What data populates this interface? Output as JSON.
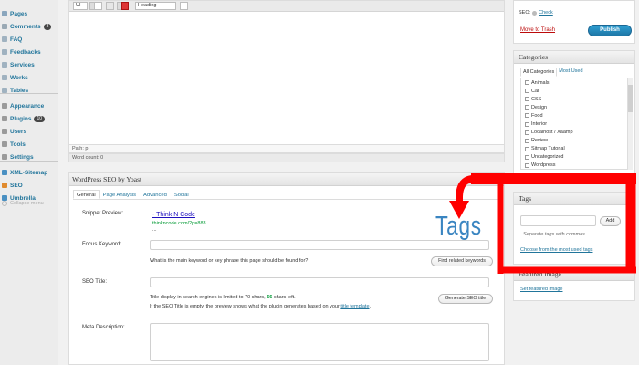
{
  "sidebar": {
    "items": [
      {
        "label": "Pages",
        "icon": "pages-icon",
        "color": "#8aa6bd"
      },
      {
        "label": "Comments",
        "icon": "comments-icon",
        "color": "#9aa9b4",
        "count": "3"
      },
      {
        "label": "FAQ",
        "icon": "faq-icon",
        "color": "#a0b2c0"
      },
      {
        "label": "Feedbacks",
        "icon": "feedbacks-icon",
        "color": "#a0b2c0"
      },
      {
        "label": "Services",
        "icon": "services-icon",
        "color": "#a0b2c0"
      },
      {
        "label": "Works",
        "icon": "works-icon",
        "color": "#a0b2c0"
      },
      {
        "label": "Tables",
        "icon": "tables-icon",
        "color": "#a0b2c0"
      },
      {
        "label": "Appearance",
        "icon": "appearance-icon",
        "color": "#9a9a9a"
      },
      {
        "label": "Plugins",
        "icon": "plugins-icon",
        "color": "#9a9a9a",
        "count": "10"
      },
      {
        "label": "Users",
        "icon": "users-icon",
        "color": "#9a9a9a"
      },
      {
        "label": "Tools",
        "icon": "tools-icon",
        "color": "#9a9a9a"
      },
      {
        "label": "Settings",
        "icon": "settings-icon",
        "color": "#9a9a9a"
      },
      {
        "label": "XML-Sitemap",
        "icon": "sitemap-icon",
        "color": "#4a90c2"
      },
      {
        "label": "SEO",
        "icon": "seo-icon",
        "color": "#e08a2e"
      },
      {
        "label": "Umbrella",
        "icon": "umbrella-icon",
        "color": "#4a90c2"
      }
    ],
    "collapse_label": "Collapse menu"
  },
  "editor": {
    "toolbar": {
      "format_select": "Heading",
      "list_select": "UI"
    },
    "path_label": "Path: p",
    "word_count": "Word count: 0"
  },
  "seo": {
    "title": "WordPress SEO by Yoast",
    "tabs": [
      "General",
      "Page Analysis",
      "Advanced",
      "Social"
    ],
    "snippet_label": "Snippet Preview:",
    "snippet_title": "- Think N Code",
    "snippet_url": "thinkncode.com/?p=883",
    "snippet_desc": "...",
    "focus_label": "Focus Keyword:",
    "focus_help": "What is the main keyword or key phrase this page should be found for?",
    "focus_button": "Find related keywords",
    "title_label": "SEO Title:",
    "title_help_pre": "Title display in search engines is limited to 70 chars,",
    "title_help_num": "56",
    "title_help_post": "chars left.",
    "title_help2_pre": "If the SEO Title is empty, the preview shows what the plugin generates based on your",
    "title_help2_link": "title template",
    "title_help2_end": ".",
    "title_button": "Generate SEO title",
    "meta_label": "Meta Description:"
  },
  "publish": {
    "seo_label": "SEO:",
    "seo_check": "Check",
    "trash_label": "Move to Trash",
    "publish_button": "Publish"
  },
  "categories": {
    "title": "Categories",
    "tab_all": "All Categories",
    "tab_used": "Most Used",
    "items": [
      "Animals",
      "Car",
      "CSS",
      "Design",
      "Food",
      "Interior",
      "Localhost / Xaamp",
      "Review",
      "Sitmap Tutorial",
      "Uncategorized",
      "Wordpress"
    ]
  },
  "tags": {
    "title": "Tags",
    "add_button": "Add",
    "hint": "Separate tags with commas",
    "choose_link": "Choose from the most used tags"
  },
  "featured": {
    "title": "Featured Image",
    "link": "Set featured image"
  },
  "annotation": {
    "label": "Tags",
    "frame_color": "#ff0000",
    "label_color": "#3a85c1"
  }
}
